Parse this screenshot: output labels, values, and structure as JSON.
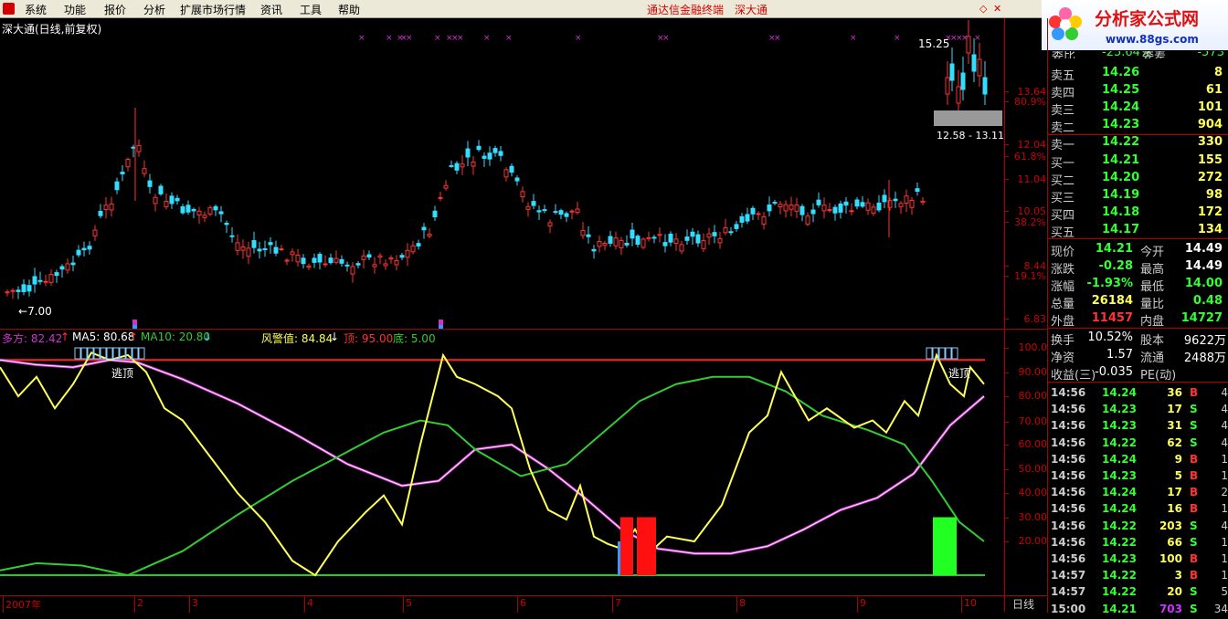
{
  "menu": {
    "items": [
      "系统",
      "功能",
      "报价",
      "分析",
      "扩展市场行情",
      "资讯",
      "工具",
      "帮助"
    ],
    "center_text": "通达信金融终端",
    "center_stock": "深大通"
  },
  "logo": {
    "title": "分析家公式网",
    "url": "www.88gs.com"
  },
  "chart": {
    "title": "深大通(日线,前复权)",
    "price_axis": [
      "13.64",
      "80.9%",
      "12.04",
      "61.8%",
      "11.04",
      "10.05",
      "38.2%",
      "8.44",
      "19.1%",
      "6.83"
    ],
    "hi_label": "15.25",
    "lo_label": "7.00",
    "range_label": "12.58 - 13.11",
    "dates": [
      "2007年",
      "2",
      "3",
      "4",
      "5",
      "6",
      "7",
      "8",
      "9",
      "10"
    ],
    "bottom_tab": "日线"
  },
  "indicator": {
    "duofang_label": "多方: 82.42",
    "ma5_label": "MA5: 80.68",
    "ma10_label": "MA10: 20.80",
    "warn_label": "风警值: 84.84",
    "top_label": "顶: 95.00",
    "bottom_label": "底: 5.00",
    "escape_label": "逃顶",
    "axis": [
      "100.0",
      "90.00",
      "80.00",
      "70.00",
      "60.00",
      "50.00",
      "40.00",
      "30.00",
      "20.00"
    ],
    "colors": {
      "line_white": "#ffffff",
      "line_magenta": "#cc33cc",
      "line_yellow": "#ffff55",
      "line_green": "#33cc33",
      "top_line": "#ff2020",
      "bottom_line": "#22cc22"
    }
  },
  "quote": {
    "top_partial": {
      "label": "委比",
      "value": "-25.64%",
      "label2": "委差",
      "value2": "-573"
    },
    "asks": [
      {
        "label": "卖五",
        "price": "14.26",
        "vol": "8"
      },
      {
        "label": "卖四",
        "price": "14.25",
        "vol": "61"
      },
      {
        "label": "卖三",
        "price": "14.24",
        "vol": "101"
      },
      {
        "label": "卖二",
        "price": "14.23",
        "vol": "904"
      },
      {
        "label": "卖一",
        "price": "14.22",
        "vol": "330"
      }
    ],
    "bids": [
      {
        "label": "买一",
        "price": "14.21",
        "vol": "155"
      },
      {
        "label": "买二",
        "price": "14.20",
        "vol": "272"
      },
      {
        "label": "买三",
        "price": "14.19",
        "vol": "98"
      },
      {
        "label": "买四",
        "price": "14.18",
        "vol": "172"
      },
      {
        "label": "买五",
        "price": "14.17",
        "vol": "134"
      }
    ],
    "stats": [
      {
        "l1": "现价",
        "v1": "14.21",
        "c1": "#33ff33",
        "l2": "今开",
        "v2": "14.49",
        "c2": "#ffffff"
      },
      {
        "l1": "涨跌",
        "v1": "-0.28",
        "c1": "#33ff33",
        "l2": "最高",
        "v2": "14.49",
        "c2": "#ffffff"
      },
      {
        "l1": "涨幅",
        "v1": "-1.93%",
        "c1": "#33ff33",
        "l2": "最低",
        "v2": "14.00",
        "c2": "#33ff33"
      },
      {
        "l1": "总量",
        "v1": "26184",
        "c1": "#ffff55",
        "l2": "量比",
        "v2": "0.48",
        "c2": "#33ff33"
      },
      {
        "l1": "外盘",
        "v1": "11457",
        "c1": "#ff3333",
        "l2": "内盘",
        "v2": "14727",
        "c2": "#33ff33"
      }
    ],
    "stats2": [
      {
        "l1": "换手",
        "v1": "10.52%",
        "l2": "股本",
        "v2": "9622万"
      },
      {
        "l1": "净资",
        "v1": "1.57",
        "l2": "流通",
        "v2": "2488万"
      },
      {
        "l1": "收益(三)",
        "v1": "-0.035",
        "l2": "PE(动)",
        "v2": ""
      }
    ],
    "ticks": [
      {
        "t": "14:56",
        "p": "14.24",
        "v": "36",
        "bs": "B",
        "n": "4"
      },
      {
        "t": "14:56",
        "p": "14.23",
        "v": "17",
        "bs": "S",
        "n": "4"
      },
      {
        "t": "14:56",
        "p": "14.23",
        "v": "31",
        "bs": "S",
        "n": "4"
      },
      {
        "t": "14:56",
        "p": "14.22",
        "v": "62",
        "bs": "S",
        "n": "4"
      },
      {
        "t": "14:56",
        "p": "14.24",
        "v": "9",
        "bs": "B",
        "n": "1"
      },
      {
        "t": "14:56",
        "p": "14.23",
        "v": "5",
        "bs": "B",
        "n": "1"
      },
      {
        "t": "14:56",
        "p": "14.24",
        "v": "17",
        "bs": "B",
        "n": "2"
      },
      {
        "t": "14:56",
        "p": "14.24",
        "v": "16",
        "bs": "B",
        "n": "1"
      },
      {
        "t": "14:56",
        "p": "14.22",
        "v": "203",
        "bs": "S",
        "n": "4"
      },
      {
        "t": "14:56",
        "p": "14.22",
        "v": "66",
        "bs": "S",
        "n": "1"
      },
      {
        "t": "14:56",
        "p": "14.23",
        "v": "100",
        "bs": "B",
        "n": "1"
      },
      {
        "t": "14:57",
        "p": "14.22",
        "v": "3",
        "bs": "B",
        "n": "1"
      },
      {
        "t": "14:57",
        "p": "14.22",
        "v": "20",
        "bs": "S",
        "n": "5"
      },
      {
        "t": "15:00",
        "p": "14.21",
        "v": "703",
        "bs": "S",
        "n": "34"
      }
    ]
  }
}
